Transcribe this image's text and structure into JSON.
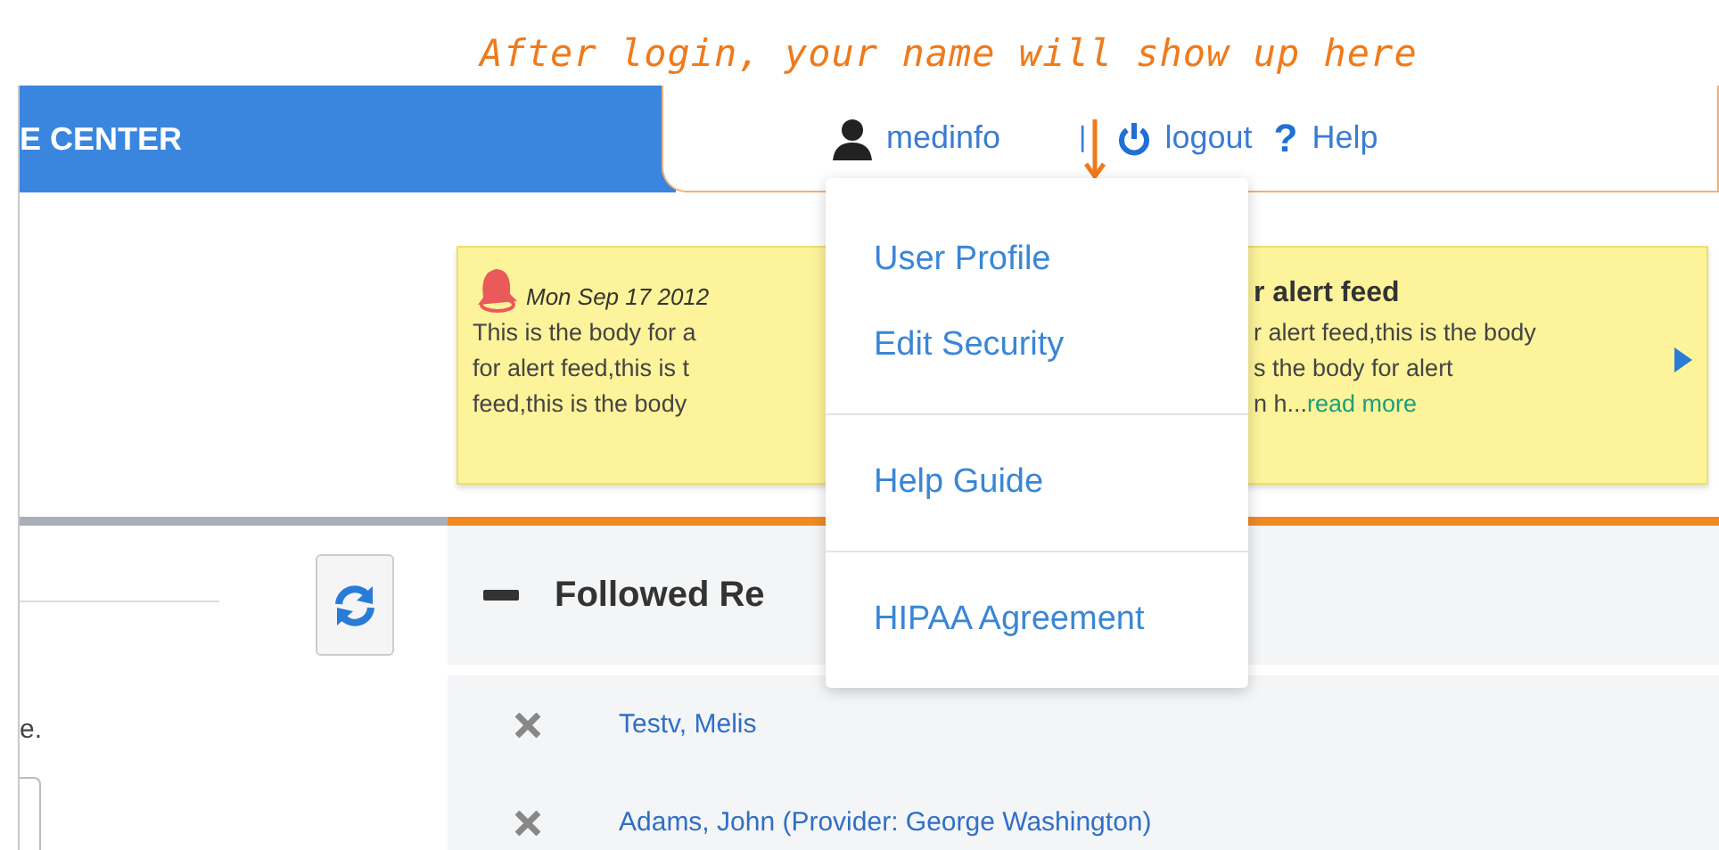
{
  "annotation": "After login, your name will show up here",
  "header": {
    "title": "E CENTER",
    "user": "medinfo",
    "separator": "|",
    "logout": "logout",
    "help_icon": "?",
    "help": "Help"
  },
  "user_menu": {
    "sections": [
      [
        "User Profile",
        "Edit Security"
      ],
      [
        "Help Guide"
      ],
      [
        "HIPAA Agreement"
      ]
    ]
  },
  "alert": {
    "date": "Mon Sep 17 2012",
    "left_lines": [
      "This is the body for a",
      "for alert feed,this is t",
      "feed,this is the body"
    ],
    "title": "r alert feed",
    "right_lines": [
      "r alert feed,this is the body",
      "s the body for alert",
      "n h..."
    ],
    "read_more": "read more"
  },
  "left_panel": {
    "partial_text": "e."
  },
  "followed": {
    "title": "Followed Re",
    "rows": [
      "Testv, Melis",
      "Adams, John (Provider: George Washington)"
    ]
  }
}
